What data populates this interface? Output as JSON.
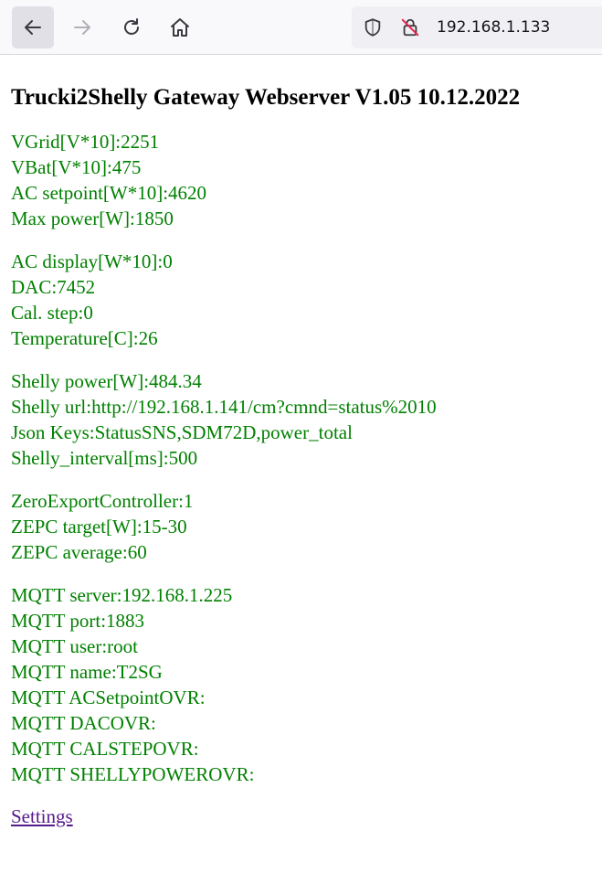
{
  "browser": {
    "url": "192.168.1.133"
  },
  "page": {
    "title": "Trucki2Shelly Gateway Webserver V1.05 10.12.2022",
    "groups": [
      [
        "VGrid[V*10]:2251",
        "VBat[V*10]:475",
        "AC setpoint[W*10]:4620",
        "Max power[W]:1850"
      ],
      [
        "AC display[W*10]:0",
        "DAC:7452",
        "Cal. step:0",
        "Temperature[C]:26"
      ],
      [
        "Shelly power[W]:484.34",
        "Shelly url:http://192.168.1.141/cm?cmnd=status%2010",
        "Json Keys:StatusSNS,SDM72D,power_total",
        "Shelly_interval[ms]:500"
      ],
      [
        "ZeroExportController:1",
        "ZEPC target[W]:15-30",
        "ZEPC average:60"
      ],
      [
        "MQTT server:192.168.1.225",
        "MQTT port:1883",
        "MQTT user:root",
        "MQTT name:T2SG",
        "MQTT ACSetpointOVR:",
        "MQTT DACOVR:",
        "MQTT CALSTEPOVR:",
        "MQTT SHELLYPOWEROVR:"
      ]
    ],
    "settings_link": "Settings"
  },
  "colors": {
    "value_text": "#008000",
    "link": "#551a8b"
  }
}
